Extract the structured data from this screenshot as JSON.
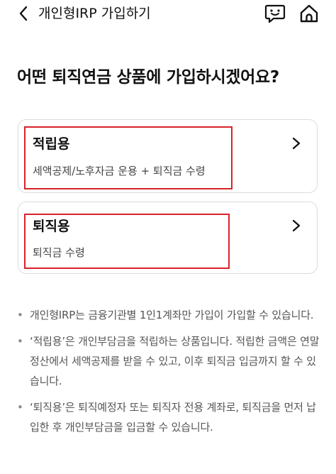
{
  "header": {
    "back_icon": "chevron-left-icon",
    "title": "개인형IRP 가입하기",
    "chat_icon": "chat-smile-icon",
    "home_icon": "home-icon"
  },
  "main": {
    "question": "어떤 퇴직연금 상품에 가입하시겠어요?",
    "options": [
      {
        "title": "적립용",
        "subtitle": "세액공제/노후자금 운용 + 퇴직금 수령"
      },
      {
        "title": "퇴직용",
        "subtitle": "퇴직금 수령"
      }
    ],
    "highlight_color": "#d8232a"
  },
  "notes": [
    "개인형IRP는 금융기관별 1인1계좌만 가입이 가입할 수 있습니다.",
    "‘적립용’은 개인부담금을 적립하는 상품입니다. 적립한 금액은 연말정산에서 세액공제를 받을 수 있고, 이후 퇴직금 입금까지 할 수 있습니다.",
    "‘퇴직용’은 퇴직예정자 또는 퇴직자 전용 계좌로, 퇴직금을 먼저 납입한 후 개인부담금을 입금할 수 있습니다."
  ]
}
